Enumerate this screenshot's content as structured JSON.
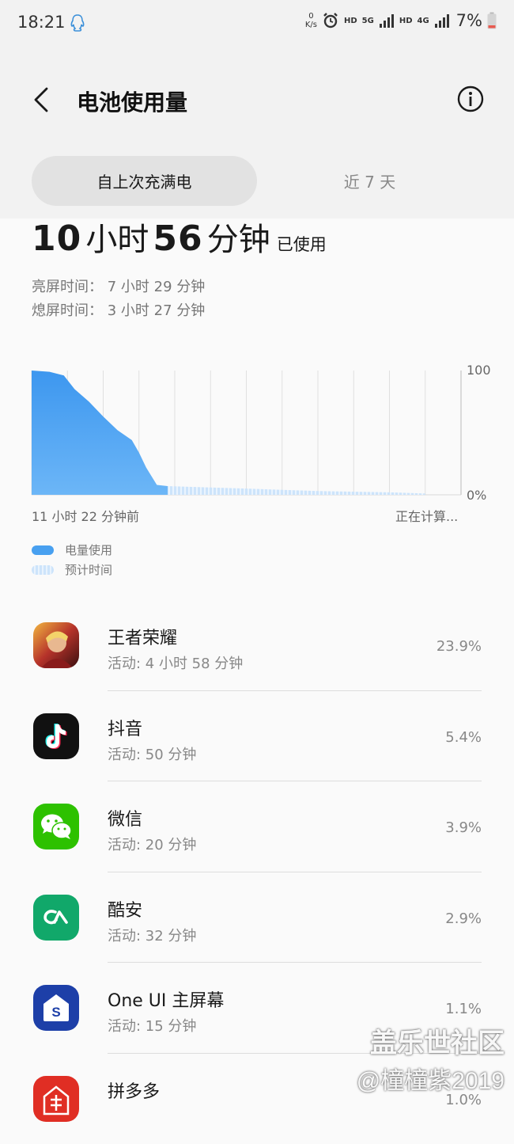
{
  "status_bar": {
    "time": "18:21",
    "net_speed_value": "0",
    "net_speed_unit": "K/s",
    "hd_label_1": "HD",
    "network_5g": "5G",
    "hd_label_2": "HD",
    "network_4g": "4G",
    "battery_percent": "7%",
    "icons": [
      "qq-icon",
      "alarm-icon",
      "signal-icon",
      "battery-icon"
    ]
  },
  "header": {
    "title": "电池使用量"
  },
  "tabs": [
    {
      "label": "自上次充满电",
      "selected": true
    },
    {
      "label": "近 7 天",
      "selected": false
    }
  ],
  "summary": {
    "hours": "10",
    "hours_unit": "小时",
    "minutes": "56",
    "minutes_unit": "分钟",
    "used_label": "已使用",
    "screen_on": "亮屏时间：  7 小时 29 分钟",
    "screen_off": "熄屏时间：  3 小时 27 分钟"
  },
  "chart_data": {
    "type": "area",
    "y_tick_labels": [
      "100",
      "0%"
    ],
    "x_start_label": "11 小时 22 分钟前",
    "x_end_label": "正在计算...",
    "ylim": [
      0,
      100
    ],
    "xlim": [
      0,
      12
    ],
    "grid": true,
    "series": [
      {
        "name": "电量使用",
        "color": "#48a0f0",
        "x": [
          0,
          0.5,
          0.9,
          1.2,
          1.6,
          2.0,
          2.4,
          2.8,
          3.0,
          3.2,
          3.5,
          3.8
        ],
        "values": [
          100,
          99,
          96,
          85,
          75,
          63,
          52,
          44,
          34,
          22,
          8,
          7
        ]
      },
      {
        "name": "预计时间",
        "color": "#cde4fb",
        "x": [
          3.8,
          6,
          8,
          10,
          11
        ],
        "values": [
          7,
          5,
          3,
          2,
          1
        ]
      }
    ],
    "legend": [
      "电量使用",
      "预计时间"
    ]
  },
  "apps": [
    {
      "name": "王者荣耀",
      "activity": "活动: 4 小时 58 分钟",
      "percent": "23.9%",
      "icon": "honor-of-kings-icon"
    },
    {
      "name": "抖音",
      "activity": "活动: 50 分钟",
      "percent": "5.4%",
      "icon": "douyin-icon"
    },
    {
      "name": "微信",
      "activity": "活动: 20 分钟",
      "percent": "3.9%",
      "icon": "wechat-icon"
    },
    {
      "name": "酷安",
      "activity": "活动: 32 分钟",
      "percent": "2.9%",
      "icon": "coolapk-icon"
    },
    {
      "name": "One UI 主屏幕",
      "activity": "活动: 15 分钟",
      "percent": "1.1%",
      "icon": "oneui-home-icon"
    },
    {
      "name": "拼多多",
      "activity": "",
      "percent": "1.0%",
      "icon": "pinduoduo-icon"
    }
  ],
  "watermark": {
    "line1": "盖乐世社区",
    "line2": "@橦橦紫2019"
  }
}
